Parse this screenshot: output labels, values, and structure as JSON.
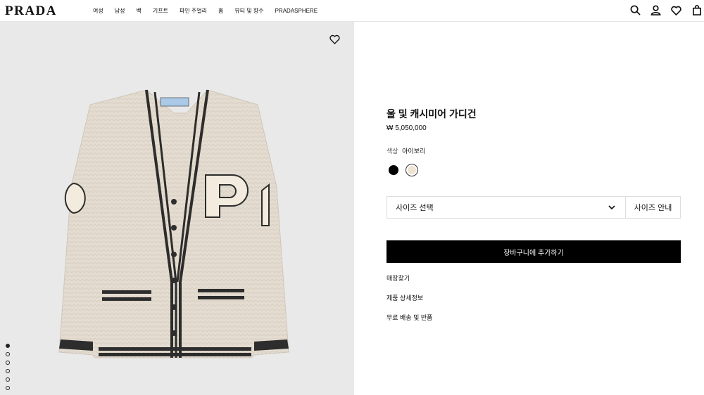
{
  "header": {
    "logo": "PRADA",
    "nav": [
      "여성",
      "남성",
      "백",
      "기프트",
      "파인 주얼리",
      "홈",
      "뷰티 및 향수",
      "PRADASPHERE"
    ],
    "icons": [
      "search-icon",
      "account-icon",
      "wishlist-icon",
      "bag-icon"
    ]
  },
  "gallery": {
    "image": "ivory-cardigan-photo",
    "slides_total": 6,
    "active_slide": 1
  },
  "product": {
    "title": "울 및 캐시미어 가디건",
    "price": "₩ 5,050,000",
    "color_label": "색상",
    "color_value": "아이보리",
    "colors": [
      "#000000",
      "#efe3d3"
    ],
    "size_select": "사이즈 선택",
    "size_guide": "사이즈 안내",
    "add_to_cart": "장바구니에 추가하기",
    "links": [
      "매장찾기",
      "제품 상세정보",
      "무료 배송 및 반품"
    ]
  }
}
